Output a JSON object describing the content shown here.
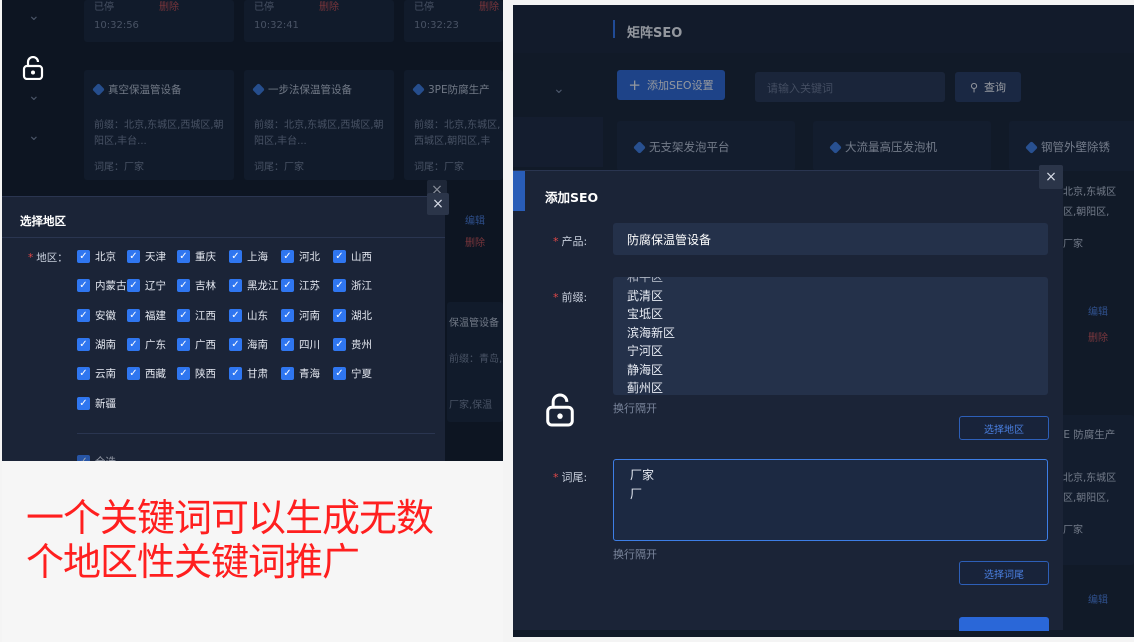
{
  "left": {
    "top_rows": [
      {
        "status": "已停",
        "time": "10:32:56",
        "action": "删除"
      },
      {
        "status": "已停",
        "time": "10:32:41",
        "action": "删除"
      },
      {
        "status": "已停",
        "time": "10:32:23",
        "action": "删除"
      }
    ],
    "cards": [
      {
        "title": "真空保温管设备",
        "prefix_label": "前缀：",
        "prefix": "北京,东城区,西城区,朝阳区,丰台...",
        "suffix_label": "词尾：",
        "suffix": "厂家"
      },
      {
        "title": "一步法保温管设备",
        "prefix_label": "前缀：",
        "prefix": "北京,东城区,西城区,朝阳区,丰台...",
        "suffix_label": "词尾：",
        "suffix": "厂家"
      },
      {
        "title": "3PE防腐生产",
        "prefix_label": "前缀：",
        "prefix": "北京,东城区,西城区,朝阳区,丰台...",
        "suffix_label": "词尾：",
        "suffix": "厂家"
      }
    ],
    "right_peek": {
      "edit": "编辑",
      "del": "删除",
      "title": "保温管设备",
      "prefix": "前缀：青岛,即墨,胶州,",
      "suffix": "厂家,保温"
    },
    "modal": {
      "title": "选择地区",
      "close": "×",
      "field_label": "地区：",
      "regions": [
        [
          "北京",
          "天津",
          "重庆",
          "上海",
          "河北",
          "山西"
        ],
        [
          "内蒙古",
          "辽宁",
          "吉林",
          "黑龙江",
          "江苏",
          "浙江"
        ],
        [
          "安徽",
          "福建",
          "江西",
          "山东",
          "河南",
          "湖北"
        ],
        [
          "湖南",
          "广东",
          "广西",
          "海南",
          "四川",
          "贵州"
        ],
        [
          "云南",
          "西藏",
          "陕西",
          "甘肃",
          "青海",
          "宁夏"
        ],
        [
          "新疆"
        ]
      ],
      "bottom": "全选"
    }
  },
  "caption": {
    "line1": "一个关键词可以生成无数",
    "line2": "个地区性关键词推广"
  },
  "right": {
    "header": {
      "title": "矩阵SEO"
    },
    "toolbar": {
      "add_label": "添加SEO设置",
      "search_placeholder": "请输入关键词",
      "search_label": "查询"
    },
    "cards": [
      {
        "title": "无支架发泡平台"
      },
      {
        "title": "大流量高压发泡机"
      },
      {
        "title": "钢管外壁除锈"
      }
    ],
    "peek": {
      "prefix1": "北京,东城区",
      "prefix2": "区,朝阳区,",
      "suffix": "厂家",
      "edit": "编辑",
      "del": "删除",
      "card_title": "PE 防腐生产",
      "prefix3": "北京,东城区",
      "prefix4": "区,朝阳区,",
      "suffix2": "厂家",
      "edit2": "编辑"
    },
    "modal": {
      "title": "添加SEO",
      "close": "×",
      "product_label": "产品:",
      "product_value": "防腐保温管设备",
      "prefix_label": "前缀:",
      "prefix_items": [
        "和平区",
        "武清区",
        "宝坻区",
        "滨海新区",
        "宁河区",
        "静海区",
        "蓟州区"
      ],
      "prefix_hint": "换行隔开",
      "select_region": "选择地区",
      "suffix_label": "词尾:",
      "suffix_items": [
        "厂家",
        "厂"
      ],
      "suffix_hint": "换行隔开",
      "select_suffix": "选择词尾"
    }
  }
}
